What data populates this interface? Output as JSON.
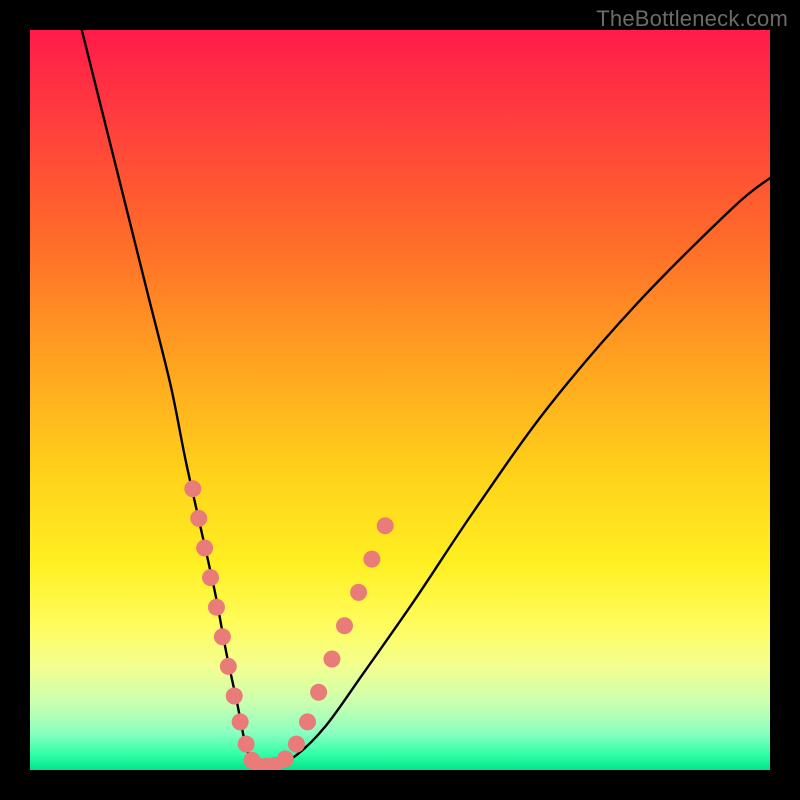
{
  "watermark": "TheBottleneck.com",
  "chart_data": {
    "type": "line",
    "title": "",
    "xlabel": "",
    "ylabel": "",
    "xlim": [
      0,
      100
    ],
    "ylim": [
      0,
      100
    ],
    "grid": false,
    "legend": false,
    "series": [
      {
        "name": "bottleneck-curve",
        "x": [
          7,
          10,
          13,
          16,
          19,
          21,
          23,
          25,
          26.5,
          28,
          29,
          30,
          31,
          33,
          36,
          40,
          45,
          52,
          60,
          70,
          82,
          95,
          100
        ],
        "y": [
          100,
          88,
          76,
          64,
          52,
          42,
          33,
          24,
          16,
          9,
          4,
          1,
          0.5,
          0.5,
          2,
          6,
          13,
          23,
          35,
          49,
          63,
          76,
          80
        ]
      }
    ],
    "markers": {
      "name": "highlight-dots",
      "color": "#e97b78",
      "points": [
        {
          "x": 22.0,
          "y": 38
        },
        {
          "x": 22.8,
          "y": 34
        },
        {
          "x": 23.6,
          "y": 30
        },
        {
          "x": 24.4,
          "y": 26
        },
        {
          "x": 25.2,
          "y": 22
        },
        {
          "x": 26.0,
          "y": 18
        },
        {
          "x": 26.8,
          "y": 14
        },
        {
          "x": 27.6,
          "y": 10
        },
        {
          "x": 28.4,
          "y": 6.5
        },
        {
          "x": 29.2,
          "y": 3.5
        },
        {
          "x": 30.0,
          "y": 1.3
        },
        {
          "x": 31.0,
          "y": 0.5
        },
        {
          "x": 32.0,
          "y": 0.5
        },
        {
          "x": 33.0,
          "y": 0.6
        },
        {
          "x": 34.5,
          "y": 1.5
        },
        {
          "x": 36.0,
          "y": 3.5
        },
        {
          "x": 37.5,
          "y": 6.5
        },
        {
          "x": 39.0,
          "y": 10.5
        },
        {
          "x": 40.8,
          "y": 15.0
        },
        {
          "x": 42.5,
          "y": 19.5
        },
        {
          "x": 44.4,
          "y": 24.0
        },
        {
          "x": 46.2,
          "y": 28.5
        },
        {
          "x": 48.0,
          "y": 33.0
        }
      ]
    }
  }
}
